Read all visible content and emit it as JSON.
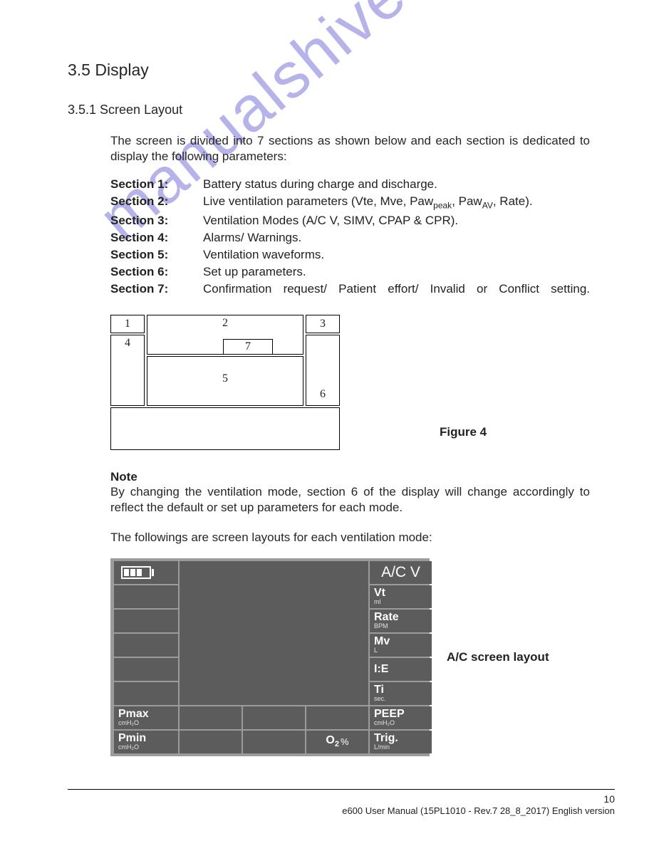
{
  "headings": {
    "h1": "3.5 Display",
    "h2": "3.5.1 Screen Layout"
  },
  "intro": "The screen is divided into 7 sections as shown below and each section is dedicated to display the following parameters:",
  "sections": [
    {
      "label": "Section 1:",
      "desc_html": "Battery status during charge and discharge."
    },
    {
      "label": "Section 2:",
      "desc_html": "Live ventilation parameters (Vte, Mve, Paw<span class='sub'>peak</span>, Paw<span class='sub'>AV</span>, Rate)."
    },
    {
      "label": "Section 3:",
      "desc_html": "Ventilation Modes (A/C V, SIMV, CPAP & CPR)."
    },
    {
      "label": "Section 4:",
      "desc_html": "Alarms/ Warnings."
    },
    {
      "label": "Section 5:",
      "desc_html": "Ventilation waveforms."
    },
    {
      "label": "Section 6:",
      "desc_html": "Set up parameters."
    },
    {
      "label": "Section 7:",
      "desc_html": "Confirmation request/ Patient effort/ Invalid or Conflict setting."
    }
  ],
  "diagram": {
    "boxes": [
      "1",
      "2",
      "3",
      "4",
      "5",
      "6",
      "7"
    ],
    "caption": "Figure 4"
  },
  "note": {
    "label": "Note",
    "text": "By changing the ventilation mode, section 6 of the display will change accordingly to reflect the default or set up parameters for each mode."
  },
  "lead2": "The followings are screen layouts for each ventilation mode:",
  "screenshot": {
    "mode": "A/C V",
    "sidebar": [
      {
        "name": "Vt",
        "unit": "ml"
      },
      {
        "name": "Rate",
        "unit": "BPM"
      },
      {
        "name": "Mv",
        "unit": "L"
      },
      {
        "name": "I:E",
        "unit": ""
      },
      {
        "name": "Ti",
        "unit": "sec."
      },
      {
        "name": "PEEP",
        "unit": "cmH₂O"
      },
      {
        "name": "Trig.",
        "unit": "L/min"
      }
    ],
    "bottom_left": [
      {
        "name": "Pmax",
        "unit": "cmH₂O"
      },
      {
        "name": "Pmin",
        "unit": "cmH₂O"
      }
    ],
    "bottom_center_o2": "O₂ %",
    "label": "A/C screen layout"
  },
  "footer": {
    "page": "10",
    "line": "e600 User Manual    (15PL1010 - Rev.7  28_8_2017)    English version"
  },
  "watermark": "manualshive.com"
}
